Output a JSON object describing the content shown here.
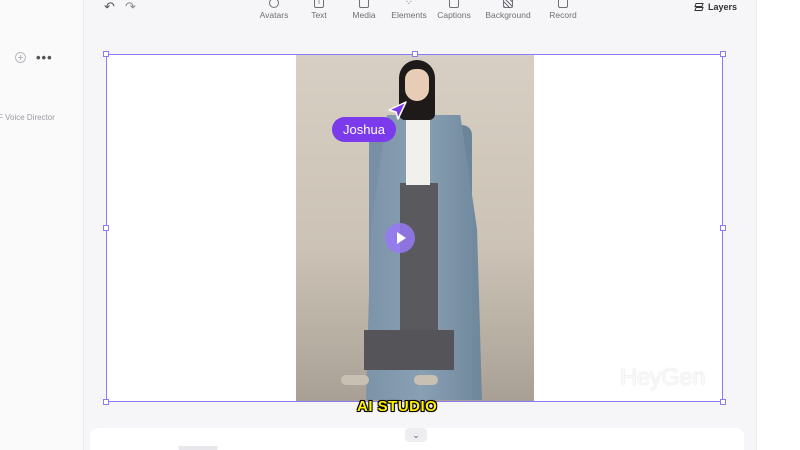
{
  "left_panel": {
    "voice_director_label": "F Voice Director",
    "more_label": "•••"
  },
  "toolbar": {
    "undo_icon": "↶",
    "redo_icon": "↷",
    "tools": [
      {
        "label": "Avatars",
        "icon": "avatar-icon"
      },
      {
        "label": "Text",
        "icon": "text-icon"
      },
      {
        "label": "Media",
        "icon": "media-icon"
      },
      {
        "label": "Elements",
        "icon": "elements-icon"
      },
      {
        "label": "Captions",
        "icon": "captions-icon"
      },
      {
        "label": "Background",
        "icon": "background-icon"
      },
      {
        "label": "Record",
        "icon": "record-icon"
      }
    ],
    "layers_label": "Layers"
  },
  "canvas": {
    "avatar_name": "Joshua",
    "watermark": "HeyGen",
    "caption": "AI STUDIO",
    "accent_color": "#7c3aed",
    "selection_color": "#8b7cf6"
  },
  "timeline": {
    "collapse_icon": "chevron-down-icon"
  }
}
